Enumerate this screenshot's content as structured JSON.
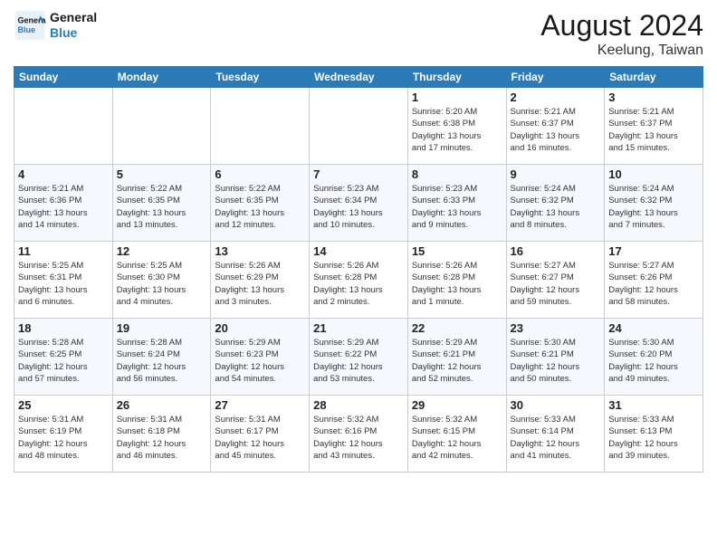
{
  "header": {
    "logo_line1": "General",
    "logo_line2": "Blue",
    "title": "August 2024",
    "location": "Keelung, Taiwan"
  },
  "days_of_week": [
    "Sunday",
    "Monday",
    "Tuesday",
    "Wednesday",
    "Thursday",
    "Friday",
    "Saturday"
  ],
  "weeks": [
    [
      {
        "day": "",
        "info": ""
      },
      {
        "day": "",
        "info": ""
      },
      {
        "day": "",
        "info": ""
      },
      {
        "day": "",
        "info": ""
      },
      {
        "day": "1",
        "info": "Sunrise: 5:20 AM\nSunset: 6:38 PM\nDaylight: 13 hours\nand 17 minutes."
      },
      {
        "day": "2",
        "info": "Sunrise: 5:21 AM\nSunset: 6:37 PM\nDaylight: 13 hours\nand 16 minutes."
      },
      {
        "day": "3",
        "info": "Sunrise: 5:21 AM\nSunset: 6:37 PM\nDaylight: 13 hours\nand 15 minutes."
      }
    ],
    [
      {
        "day": "4",
        "info": "Sunrise: 5:21 AM\nSunset: 6:36 PM\nDaylight: 13 hours\nand 14 minutes."
      },
      {
        "day": "5",
        "info": "Sunrise: 5:22 AM\nSunset: 6:35 PM\nDaylight: 13 hours\nand 13 minutes."
      },
      {
        "day": "6",
        "info": "Sunrise: 5:22 AM\nSunset: 6:35 PM\nDaylight: 13 hours\nand 12 minutes."
      },
      {
        "day": "7",
        "info": "Sunrise: 5:23 AM\nSunset: 6:34 PM\nDaylight: 13 hours\nand 10 minutes."
      },
      {
        "day": "8",
        "info": "Sunrise: 5:23 AM\nSunset: 6:33 PM\nDaylight: 13 hours\nand 9 minutes."
      },
      {
        "day": "9",
        "info": "Sunrise: 5:24 AM\nSunset: 6:32 PM\nDaylight: 13 hours\nand 8 minutes."
      },
      {
        "day": "10",
        "info": "Sunrise: 5:24 AM\nSunset: 6:32 PM\nDaylight: 13 hours\nand 7 minutes."
      }
    ],
    [
      {
        "day": "11",
        "info": "Sunrise: 5:25 AM\nSunset: 6:31 PM\nDaylight: 13 hours\nand 6 minutes."
      },
      {
        "day": "12",
        "info": "Sunrise: 5:25 AM\nSunset: 6:30 PM\nDaylight: 13 hours\nand 4 minutes."
      },
      {
        "day": "13",
        "info": "Sunrise: 5:26 AM\nSunset: 6:29 PM\nDaylight: 13 hours\nand 3 minutes."
      },
      {
        "day": "14",
        "info": "Sunrise: 5:26 AM\nSunset: 6:28 PM\nDaylight: 13 hours\nand 2 minutes."
      },
      {
        "day": "15",
        "info": "Sunrise: 5:26 AM\nSunset: 6:28 PM\nDaylight: 13 hours\nand 1 minute."
      },
      {
        "day": "16",
        "info": "Sunrise: 5:27 AM\nSunset: 6:27 PM\nDaylight: 12 hours\nand 59 minutes."
      },
      {
        "day": "17",
        "info": "Sunrise: 5:27 AM\nSunset: 6:26 PM\nDaylight: 12 hours\nand 58 minutes."
      }
    ],
    [
      {
        "day": "18",
        "info": "Sunrise: 5:28 AM\nSunset: 6:25 PM\nDaylight: 12 hours\nand 57 minutes."
      },
      {
        "day": "19",
        "info": "Sunrise: 5:28 AM\nSunset: 6:24 PM\nDaylight: 12 hours\nand 56 minutes."
      },
      {
        "day": "20",
        "info": "Sunrise: 5:29 AM\nSunset: 6:23 PM\nDaylight: 12 hours\nand 54 minutes."
      },
      {
        "day": "21",
        "info": "Sunrise: 5:29 AM\nSunset: 6:22 PM\nDaylight: 12 hours\nand 53 minutes."
      },
      {
        "day": "22",
        "info": "Sunrise: 5:29 AM\nSunset: 6:21 PM\nDaylight: 12 hours\nand 52 minutes."
      },
      {
        "day": "23",
        "info": "Sunrise: 5:30 AM\nSunset: 6:21 PM\nDaylight: 12 hours\nand 50 minutes."
      },
      {
        "day": "24",
        "info": "Sunrise: 5:30 AM\nSunset: 6:20 PM\nDaylight: 12 hours\nand 49 minutes."
      }
    ],
    [
      {
        "day": "25",
        "info": "Sunrise: 5:31 AM\nSunset: 6:19 PM\nDaylight: 12 hours\nand 48 minutes."
      },
      {
        "day": "26",
        "info": "Sunrise: 5:31 AM\nSunset: 6:18 PM\nDaylight: 12 hours\nand 46 minutes."
      },
      {
        "day": "27",
        "info": "Sunrise: 5:31 AM\nSunset: 6:17 PM\nDaylight: 12 hours\nand 45 minutes."
      },
      {
        "day": "28",
        "info": "Sunrise: 5:32 AM\nSunset: 6:16 PM\nDaylight: 12 hours\nand 43 minutes."
      },
      {
        "day": "29",
        "info": "Sunrise: 5:32 AM\nSunset: 6:15 PM\nDaylight: 12 hours\nand 42 minutes."
      },
      {
        "day": "30",
        "info": "Sunrise: 5:33 AM\nSunset: 6:14 PM\nDaylight: 12 hours\nand 41 minutes."
      },
      {
        "day": "31",
        "info": "Sunrise: 5:33 AM\nSunset: 6:13 PM\nDaylight: 12 hours\nand 39 minutes."
      }
    ]
  ]
}
